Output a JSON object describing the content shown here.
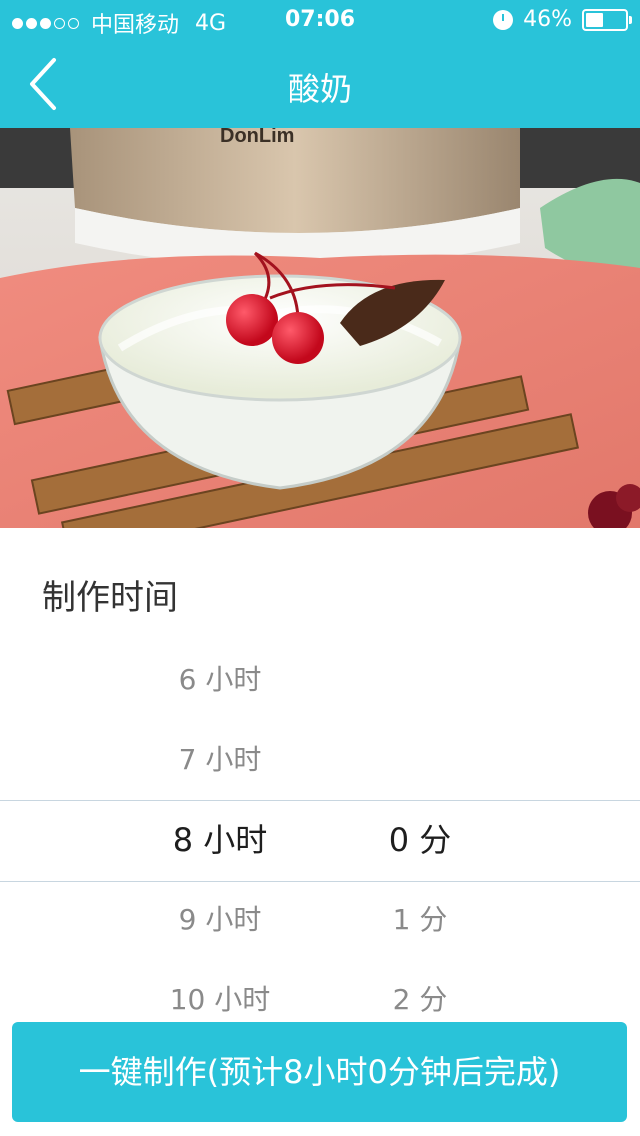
{
  "status_bar": {
    "carrier": "中国移动",
    "network": "4G",
    "time": "07:06",
    "battery": "46%",
    "battery_level": 0.46,
    "signal_bars_filled": 3,
    "signal_bars_total": 5
  },
  "nav": {
    "title": "酸奶",
    "back_icon": "chevron-left-icon"
  },
  "photo": {
    "brand": "DonLim"
  },
  "section": {
    "title": "制作时间"
  },
  "picker": {
    "hours": [
      "6 小时",
      "7 小时",
      "8 小时",
      "9 小时",
      "10 小时"
    ],
    "hours_selected_index": 2,
    "minutes": [
      "",
      "",
      "0 分",
      "1 分",
      "2 分"
    ],
    "minutes_selected_index": 2
  },
  "action_button": {
    "label": "一键制作(预计8小时0分钟后完成)"
  },
  "colors": {
    "accent": "#29c3d9",
    "text_primary": "#1e1e1e",
    "text_muted": "#8a8a8a"
  }
}
